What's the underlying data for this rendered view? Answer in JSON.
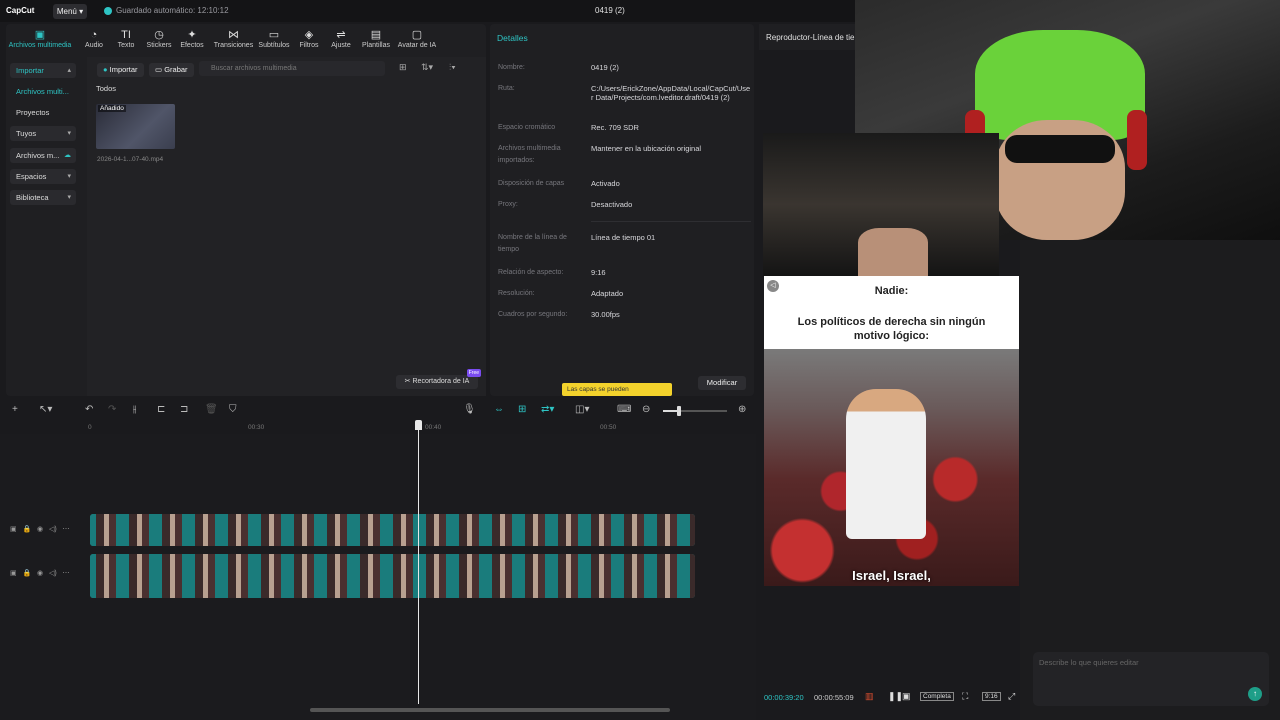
{
  "topbar": {
    "logo": "CapCut",
    "menu_label": "Menú",
    "autosave": "Guardado automático: 12:10:12",
    "project_title": "0419 (2)"
  },
  "toolbar": {
    "items": [
      {
        "label": "Archivos multimedia",
        "icon": "media-icon"
      },
      {
        "label": "Audio",
        "icon": "audio-icon"
      },
      {
        "label": "Texto",
        "icon": "text-icon"
      },
      {
        "label": "Stickers",
        "icon": "sticker-icon"
      },
      {
        "label": "Efectos",
        "icon": "effects-icon"
      },
      {
        "label": "Transiciones",
        "icon": "transitions-icon"
      },
      {
        "label": "Subtítulos",
        "icon": "subtitles-icon"
      },
      {
        "label": "Filtros",
        "icon": "filters-icon"
      },
      {
        "label": "Ajuste",
        "icon": "adjust-icon"
      },
      {
        "label": "Plantillas",
        "icon": "templates-icon"
      },
      {
        "label": "Avatar de IA",
        "icon": "ai-avatar-icon"
      }
    ]
  },
  "sidebar": {
    "items": [
      "Importar",
      "Archivos multi...",
      "Proyectos secun...",
      "Tuyos",
      "Archivos m...",
      "Espacios",
      "Biblioteca"
    ]
  },
  "media": {
    "import_label": "Importar",
    "record_label": "Grabar",
    "search_placeholder": "Buscar archivos multimedia",
    "filter_all": "Todos",
    "clip_badge": "Añadido",
    "clip_name": "2026-04-1...07-40.mp4",
    "ai_cutter": "Recortadora de IA",
    "free_badge": "Free"
  },
  "details": {
    "title": "Detalles",
    "rows": [
      {
        "label": "Nombre:",
        "value": "0419 (2)"
      },
      {
        "label": "Ruta:",
        "value": "C:/Users/ErickZone/AppData/Local/CapCut/User Data/Projects/com.lveditor.draft/0419 (2)"
      },
      {
        "label": "Espacio cromático",
        "value": "Rec. 709 SDR"
      },
      {
        "label": "Archivos multimedia importados:",
        "value": "Mantener en la ubicación original"
      },
      {
        "label": "Disposición de capas",
        "value": "Activado"
      },
      {
        "label": "Proxy:",
        "value": "Desactivado"
      },
      {
        "label": "Nombre de la línea de tiempo",
        "value": "Línea de tiempo 01"
      },
      {
        "label": "Relación de aspecto:",
        "value": "9:16"
      },
      {
        "label": "Resolución:",
        "value": "Adaptado"
      },
      {
        "label": "Cuadros por segundo:",
        "value": "30.00fps"
      }
    ],
    "tooltip": "Las capas se pueden",
    "modify_label": "Modificar"
  },
  "player": {
    "title": "Reproductor-Línea de tie",
    "meme_top": "Nadie:",
    "meme_mid": "Los políticos de derecha sin ningún motivo lógico:",
    "subtitle": "Israel, Israel,",
    "current_time": "00:00:39:20",
    "total_time": "00:00:55:09",
    "full_label": "Completa",
    "ratio_label": "9:16"
  },
  "assistant": {
    "prompt_placeholder": "Describe lo que quieres editar"
  },
  "timeline": {
    "ticks": [
      "0",
      "00:30",
      "00:40",
      "00:50"
    ]
  },
  "colors": {
    "accent": "#2ec4c4",
    "clip": "#1a7c7c",
    "tooltip": "#f3d22c"
  }
}
